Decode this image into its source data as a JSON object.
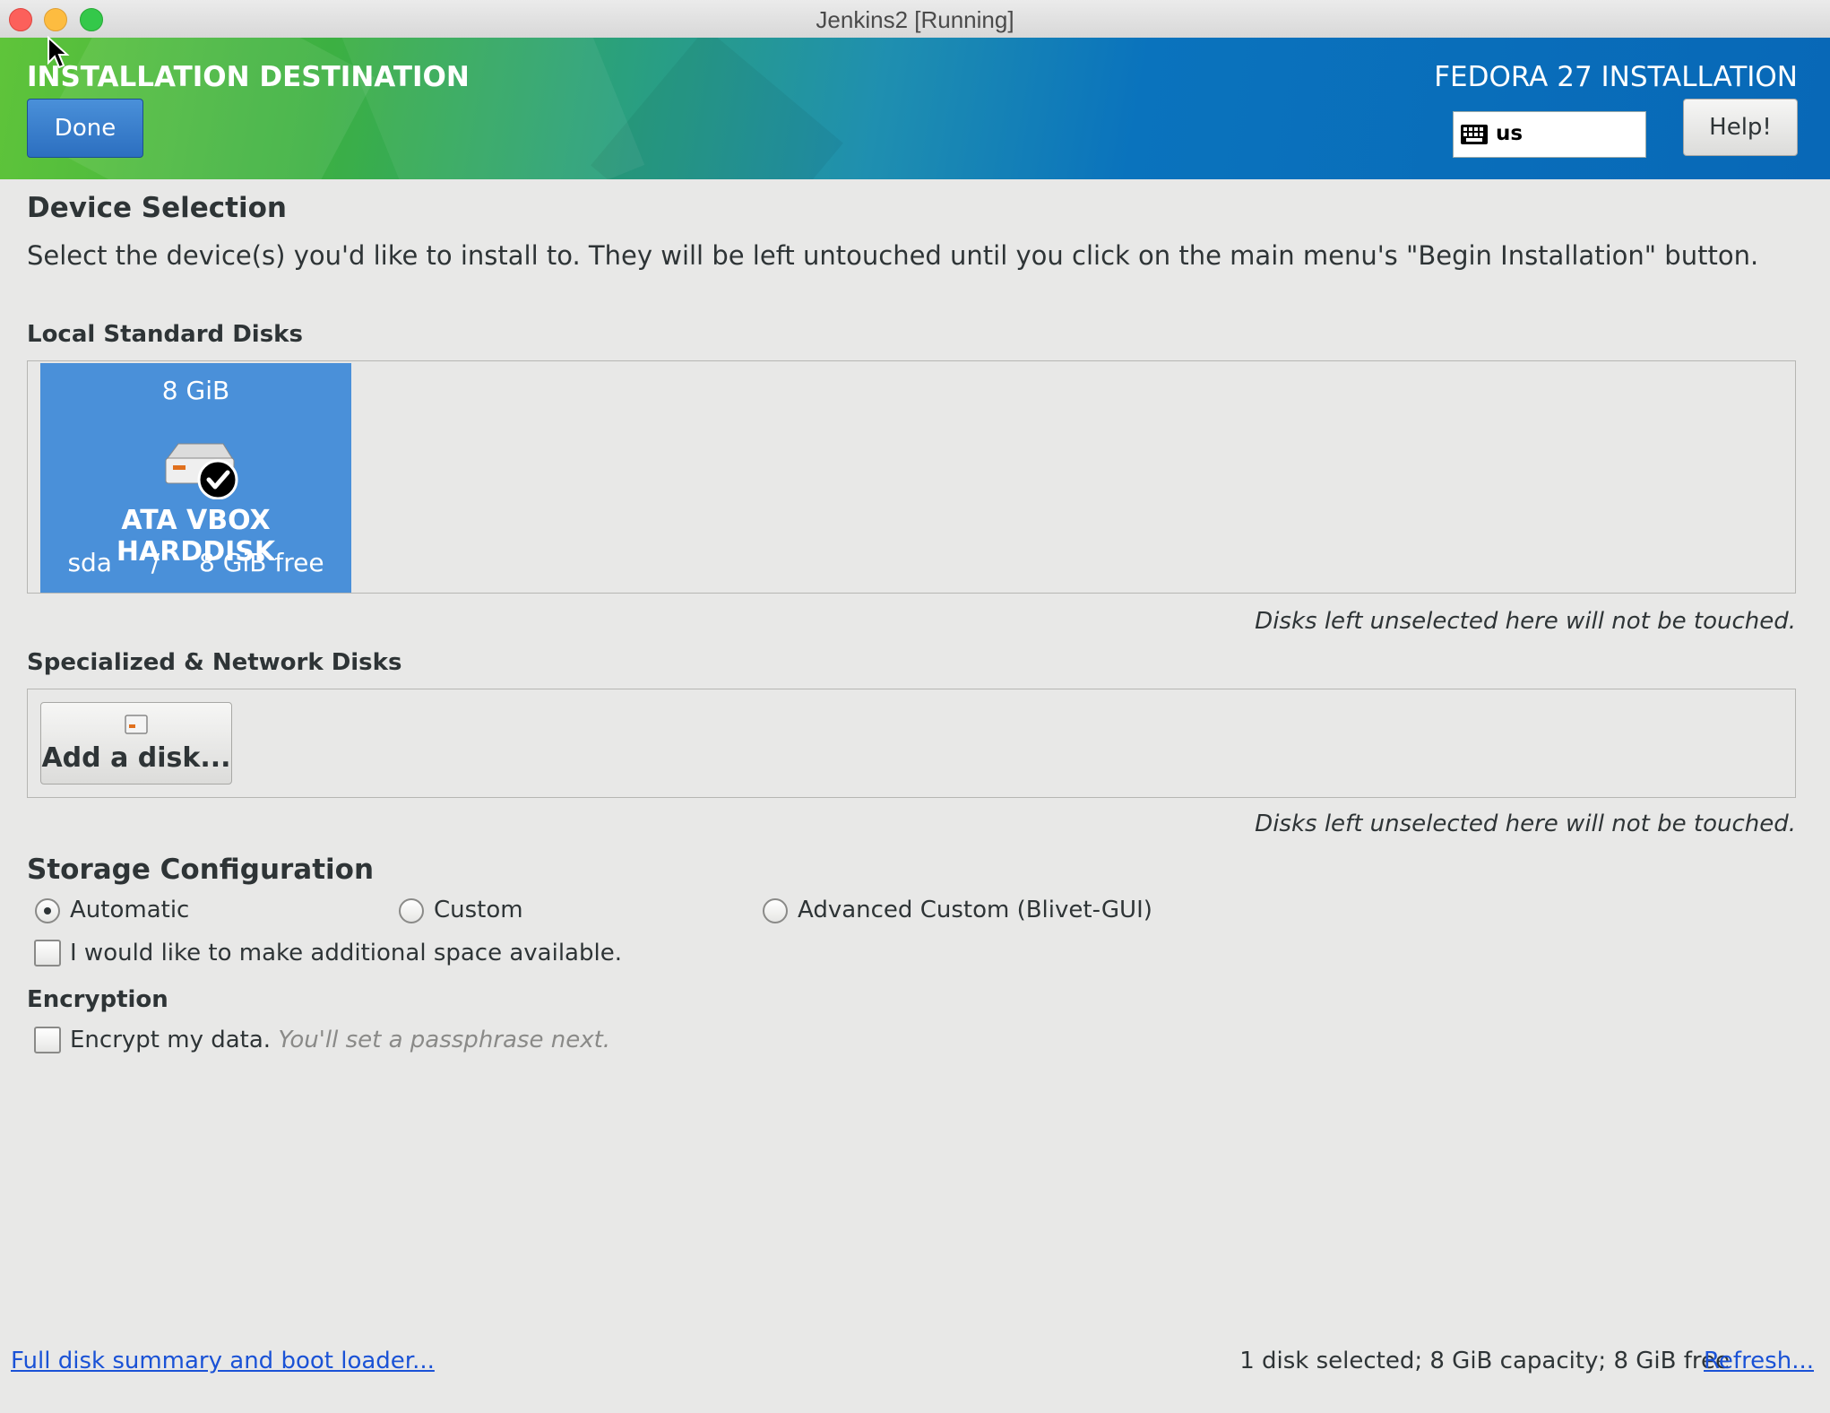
{
  "window": {
    "title": "Jenkins2 [Running]"
  },
  "header": {
    "title": "INSTALLATION DESTINATION",
    "product": "FEDORA 27 INSTALLATION",
    "done_label": "Done",
    "keyboard_layout": "us",
    "help_label": "Help!",
    "brand_colors": {
      "green": "#5fc43a",
      "blue": "#0868b7"
    }
  },
  "device_selection": {
    "title": "Device Selection",
    "description": "Select the device(s) you'd like to install to.  They will be left untouched until you click on the main menu's \"Begin Installation\" button."
  },
  "local_disks": {
    "title": "Local Standard Disks",
    "disks": [
      {
        "size": "8 GiB",
        "name": "ATA VBOX HARDDISK",
        "device": "sda",
        "separator": "/",
        "free": "8 GiB free",
        "selected": true,
        "icon": "harddisk-checked-icon"
      }
    ],
    "note": "Disks left unselected here will not be touched."
  },
  "specialized_disks": {
    "title": "Specialized & Network Disks",
    "add_label": "Add a disk...",
    "note": "Disks left unselected here will not be touched."
  },
  "storage_configuration": {
    "title": "Storage Configuration",
    "options": [
      "Automatic",
      "Custom",
      "Advanced Custom (Blivet-GUI)"
    ],
    "selected": "Automatic",
    "extra_space_label": "I would like to make additional space available.",
    "extra_space_checked": false
  },
  "encryption": {
    "title": "Encryption",
    "label": "Encrypt my data.",
    "hint": "You'll set a passphrase next.",
    "checked": false
  },
  "footer": {
    "summary_link": "Full disk summary and boot loader...",
    "status": "1 disk selected; 8 GiB capacity; 8 GiB free",
    "refresh_link": "Refresh..."
  }
}
